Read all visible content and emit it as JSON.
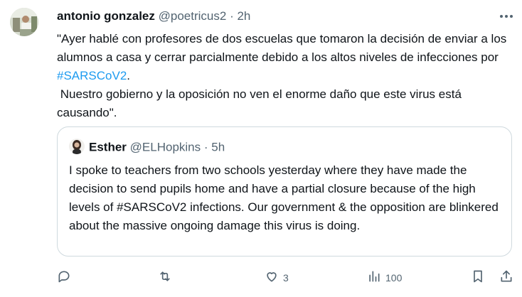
{
  "tweet": {
    "author_name": "antonio gonzalez",
    "author_handle": "@poetricus2",
    "separator": "·",
    "time": "2h",
    "text_before_hashtag": "\"Ayer hablé con profesores de dos escuelas que tomaron la decisión de enviar a los alumnos a casa y cerrar parcialmente debido a los altos niveles de infecciones por ",
    "hashtag": "#SARSCoV2",
    "text_after_hashtag": ".\n Nuestro gobierno y la oposición no ven el enorme daño que este virus está causando\".",
    "accent_color": "#1d9bf0"
  },
  "quoted": {
    "author_name": "Esther",
    "author_handle": "@ELHopkins",
    "separator": "·",
    "time": "5h",
    "text": "I spoke to teachers from two schools yesterday where they have made the decision to send pupils home and have a partial closure because of the high levels of #SARSCoV2 infections. Our government & the opposition are blinkered about the massive ongoing damage this virus is doing."
  },
  "actions": {
    "reply": {
      "icon": "reply-icon",
      "count": ""
    },
    "retweet": {
      "icon": "retweet-icon",
      "count": ""
    },
    "like": {
      "icon": "heart-icon",
      "count": "3"
    },
    "views": {
      "icon": "views-icon",
      "count": "100"
    },
    "bookmark": {
      "icon": "bookmark-icon"
    },
    "share": {
      "icon": "share-icon"
    }
  },
  "colors": {
    "text": "#0f1419",
    "secondary": "#536471",
    "border": "#cfd9de"
  }
}
